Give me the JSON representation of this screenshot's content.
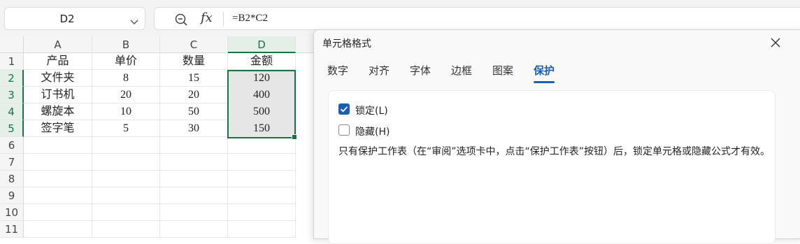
{
  "formula_bar": {
    "name_box": "D2",
    "formula": "=B2*C2",
    "fx_label": "fx",
    "icons": [
      "chevron-down-icon",
      "zoom-icon"
    ]
  },
  "sheet": {
    "columns": [
      "A",
      "B",
      "C",
      "D"
    ],
    "rows": [
      "1",
      "2",
      "3",
      "4",
      "5",
      "6",
      "7",
      "8",
      "9",
      "10",
      "11"
    ],
    "data": [
      [
        "产品",
        "单价",
        "数量",
        "金额"
      ],
      [
        "文件夹",
        "8",
        "15",
        "120"
      ],
      [
        "订书机",
        "20",
        "20",
        "400"
      ],
      [
        "螺旋本",
        "10",
        "50",
        "500"
      ],
      [
        "签字笔",
        "5",
        "30",
        "150"
      ]
    ],
    "accent": "#1e7145"
  },
  "dialog": {
    "title": "单元格格式",
    "tabs": [
      "数字",
      "对齐",
      "字体",
      "边框",
      "图案",
      "保护"
    ],
    "active_tab": "保护",
    "locked_label": "锁定(L)",
    "locked_checked": true,
    "hidden_label": "隐藏(H)",
    "hidden_checked": false,
    "note": "只有保护工作表（在“审阅”选项卡中，点击“保护工作表”按钮）后，锁定单元格或隐藏公式才有效。",
    "accent": "#1b5fb3"
  }
}
